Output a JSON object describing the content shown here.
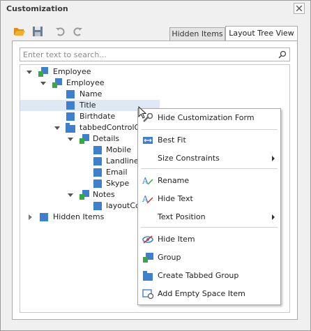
{
  "window": {
    "title": "Customization"
  },
  "tabs": {
    "hidden_items": "Hidden Items",
    "layout_tree": "Layout Tree View"
  },
  "search": {
    "placeholder": "Enter text to search..."
  },
  "tree": {
    "items": [
      {
        "label": "Employee"
      },
      {
        "label": "Employee"
      },
      {
        "label": "Name"
      },
      {
        "label": "Title"
      },
      {
        "label": "Birthdate"
      },
      {
        "label": "tabbedControlGro"
      },
      {
        "label": "Details"
      },
      {
        "label": "Mobile"
      },
      {
        "label": "Landline"
      },
      {
        "label": "Email"
      },
      {
        "label": "Skype"
      },
      {
        "label": "Notes"
      },
      {
        "label": "layoutCon"
      },
      {
        "label": "Hidden Items"
      }
    ]
  },
  "menu": {
    "hide_customization": "Hide Customization Form",
    "best_fit": "Best Fit",
    "size_constraints": "Size Constraints",
    "rename": "Rename",
    "hide_text": "Hide Text",
    "text_position": "Text Position",
    "hide_item": "Hide Item",
    "group": "Group",
    "create_tabbed_group": "Create Tabbed Group",
    "add_empty_space": "Add Empty Space Item"
  },
  "colors": {
    "accent_blue": "#3f7fd0",
    "group_green": "#3aa648",
    "selection": "#dfe9f5",
    "toolbar_orange": "#e8a020"
  },
  "icons": [
    "open-folder-icon",
    "save-icon",
    "undo-icon",
    "redo-icon",
    "search-icon",
    "close-icon"
  ]
}
